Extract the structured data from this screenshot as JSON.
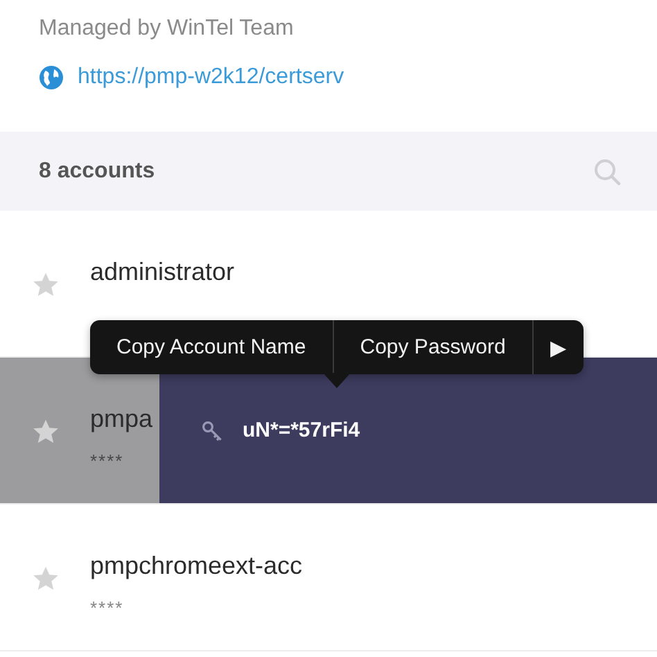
{
  "header": {
    "managed_by": "Managed by WinTel Team",
    "url": "https://pmp-w2k12/certserv"
  },
  "list_bar": {
    "count": "8 accounts"
  },
  "accounts": [
    {
      "name": "administrator",
      "favorite": false,
      "revealed": false
    },
    {
      "name": "pmpa",
      "mask": "****",
      "favorite": false,
      "revealed": true,
      "password": "uN*=*57rFi4"
    },
    {
      "name": "pmpchromeext-acc",
      "mask": "****",
      "favorite": false,
      "revealed": false
    }
  ],
  "context_menu": {
    "items": [
      "Copy Account Name",
      "Copy Password"
    ],
    "more": "▶"
  }
}
